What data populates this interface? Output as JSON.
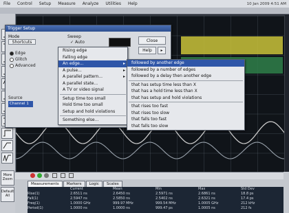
{
  "menubar": {
    "items": [
      "File",
      "Control",
      "Setup",
      "Measure",
      "Analyze",
      "Utilities",
      "Help"
    ],
    "clock": "10 Jan 2009  4:51 AM"
  },
  "dialog": {
    "title": "Trigger Setup",
    "mode_label": "Mode",
    "sweep_label": "Sweep",
    "sweep_value": "Auto",
    "shortcuts_label": "Shortcuts",
    "mode_options": [
      "Edge",
      "Glitch",
      "Advanced"
    ],
    "mode_selected": "Edge",
    "source_label": "Source",
    "source_value": "Channel 1",
    "close_label": "Close",
    "help_label": "Help"
  },
  "dropdown": {
    "items": [
      "Rising edge",
      "Falling edge",
      "An edge...",
      "A pulse...",
      "A parallel pattern...",
      "A parallel state...",
      "A TV or video signal",
      "Setup time too small",
      "Hold time too small",
      "Setup and hold violations",
      "Something else..."
    ],
    "highlighted_index": 2
  },
  "submenu": {
    "items": [
      "followed by another edge",
      "followed by a number of edges",
      "followed by a delay then another edge",
      "that has setup time less than X",
      "that has a hold time less than X",
      "that has setup and hold violations",
      "that rises too fast",
      "that rises too slow",
      "that falls too fast",
      "that falls too slow"
    ],
    "highlighted_index": 0
  },
  "sidebar": {
    "btn_more": "More Zoom",
    "btn_default": "Default All"
  },
  "tabs": [
    "Measurements",
    "Markers",
    "Logic",
    "Scales"
  ],
  "measurements": {
    "rows": [
      [
        "",
        "Current",
        "Mean",
        "Min",
        "Max",
        "Std Dev"
      ],
      [
        "Rise(1)",
        "2.6511 ns",
        "2.6450 ns",
        "2.5971 ns",
        "2.6861 ns",
        "18.8 ps"
      ],
      [
        "Fall(1)",
        "2.5947 ns",
        "2.5850 ns",
        "2.5402 ns",
        "2.6321 ns",
        "17.4 ps"
      ],
      [
        "Freq(1)",
        "1.0000 GHz",
        "999.97 MHz",
        "999.54 MHz",
        "1.0005 GHz",
        "212 kHz"
      ],
      [
        "Period(1)",
        "1.0000 ns",
        "1.0000 ns",
        "999.47 ps",
        "1.0005 ns",
        "212 fs"
      ]
    ]
  },
  "colors": {
    "trace_yellow": "#c9c23a",
    "trace_green": "#4fa06a",
    "menu_highlight": "#2f56a8"
  }
}
